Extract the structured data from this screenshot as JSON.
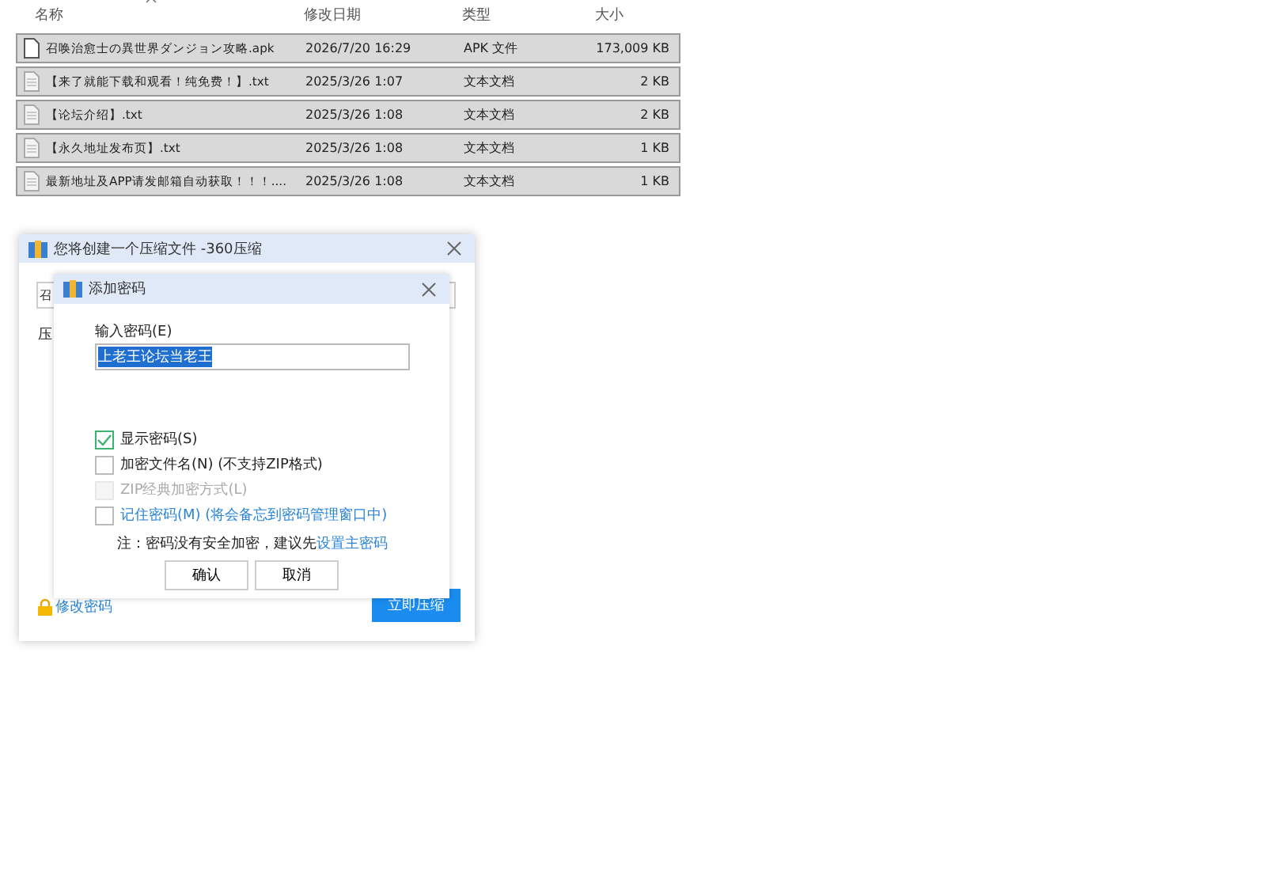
{
  "file_list": {
    "columns": [
      {
        "label": "名称",
        "sorted": true
      },
      {
        "label": "修改日期",
        "sorted": false
      },
      {
        "label": "类型",
        "sorted": false
      },
      {
        "label": "大小",
        "sorted": false
      }
    ],
    "rows": [
      {
        "kind": "apk",
        "name": "召唤治愈士の異世界ダンジョン攻略.apk",
        "date": "2026/7/20 16:29",
        "type": "APK 文件",
        "size": "173,009 KB",
        "selected": true
      },
      {
        "kind": "txt",
        "name": "【来了就能下载和观看！纯免费！】.txt",
        "date": "2025/3/26 1:07",
        "type": "文本文档",
        "size": "2 KB",
        "selected": true
      },
      {
        "kind": "txt",
        "name": "【论坛介绍】.txt",
        "date": "2025/3/26 1:08",
        "type": "文本文档",
        "size": "2 KB",
        "selected": true
      },
      {
        "kind": "txt",
        "name": "【永久地址发布页】.txt",
        "date": "2025/3/26 1:08",
        "type": "文本文档",
        "size": "1 KB",
        "selected": true
      },
      {
        "kind": "txt",
        "name": "最新地址及APP请发邮箱自动获取！！！....",
        "date": "2025/3/26 1:08",
        "type": "文本文档",
        "size": "1 KB",
        "selected": true
      }
    ]
  },
  "archive_window": {
    "title": "您将创建一个压缩文件 -360压缩",
    "field_text": "召",
    "label_text": "压",
    "change_password_link": "修改密码",
    "compress_button": "立即压缩"
  },
  "password_dialog": {
    "title": "添加密码",
    "input_label": "输入密码(E)",
    "password": "上老王论坛当老王",
    "password_selected": true,
    "options": [
      {
        "kind": "plain",
        "label": "显示密码(S)",
        "checked": true,
        "disabled": false
      },
      {
        "kind": "plain",
        "label": "加密文件名(N) (不支持ZIP格式)",
        "checked": false,
        "disabled": false
      },
      {
        "kind": "plain",
        "label": "ZIP经典加密方式(L)",
        "checked": false,
        "disabled": true
      },
      {
        "kind": "link",
        "label": "记住密码(M) (将会备忘到密码管理窗口中)",
        "checked": false,
        "disabled": false
      }
    ],
    "note": "注：密码没有安全加密，建议先",
    "note_link": "设置主密码",
    "buttons": [
      "确认",
      "取消"
    ]
  }
}
